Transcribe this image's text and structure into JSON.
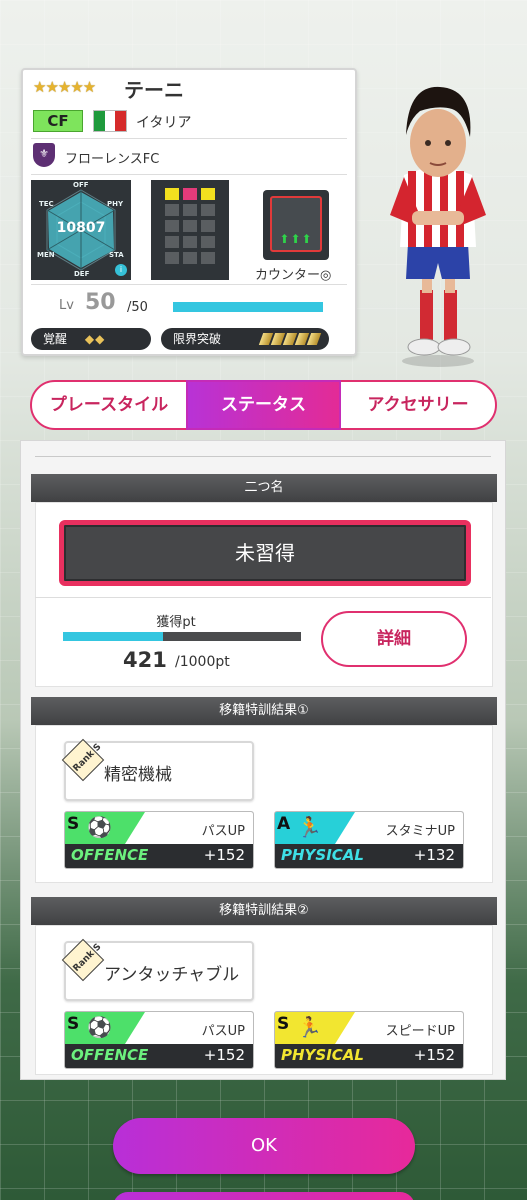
{
  "player": {
    "stars": "★★★★★",
    "name": "テーニ",
    "position": "CF",
    "country": "イタリア",
    "club": "フローレンスFC",
    "rating": "10807",
    "radar_labels": {
      "off": "OFF",
      "tec": "TEC",
      "phy": "PHY",
      "men": "MEN",
      "sta": "STA",
      "def": "DEF"
    },
    "play_style": "カウンター◎",
    "level_label": "Lv",
    "level": "50",
    "level_max": "/50",
    "level_progress": 1.0,
    "awakening_label": "覚醒",
    "awakening_marks": "◆◆",
    "limit_break_label": "限界突破"
  },
  "tabs": {
    "play_style": "プレースタイル",
    "status": "ステータス",
    "accessory": "アクセサリー"
  },
  "nickname": {
    "header": "二つ名",
    "value": "未習得",
    "pt_label": "獲得pt",
    "pt_value": "421",
    "pt_max": "/1000pt",
    "pt_progress": 0.421,
    "detail_button": "詳細"
  },
  "transfer1": {
    "header": "移籍特訓結果①",
    "rank": "Rank S",
    "skill": "精密機械",
    "boosts": [
      {
        "grade": "S",
        "label": "パスUP",
        "category": "OFFENCE",
        "value": "+152",
        "color": "#4de06a",
        "cat_color": "#6cf07e"
      },
      {
        "grade": "A",
        "label": "スタミナUP",
        "category": "PHYSICAL",
        "value": "+132",
        "color": "#27d0d8",
        "cat_color": "#3ee0e6"
      }
    ]
  },
  "transfer2": {
    "header": "移籍特訓結果②",
    "rank": "Rank S",
    "skill": "アンタッチャブル",
    "boosts": [
      {
        "grade": "S",
        "label": "パスUP",
        "category": "OFFENCE",
        "value": "+152",
        "color": "#4de06a",
        "cat_color": "#6cf07e"
      },
      {
        "grade": "S",
        "label": "スピードUP",
        "category": "PHYSICAL",
        "value": "+152",
        "color": "#f2e630",
        "cat_color": "#f2e630"
      }
    ]
  },
  "ok_button": "OK"
}
